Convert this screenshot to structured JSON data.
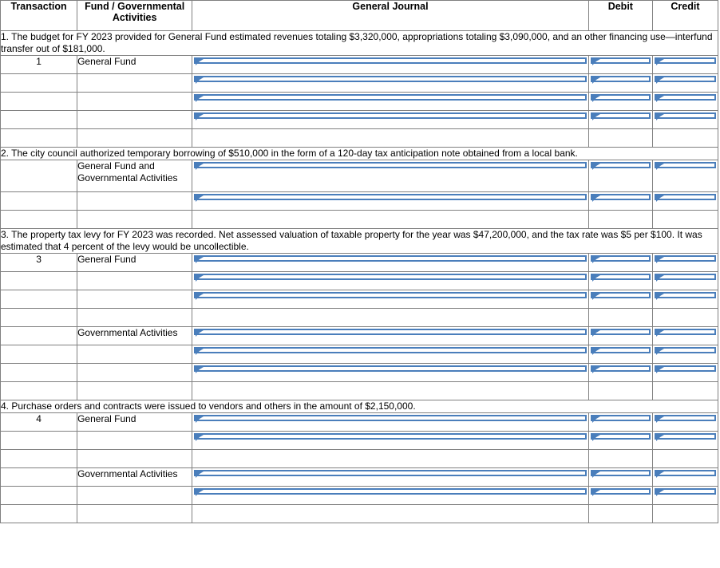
{
  "header": {
    "columns": [
      {
        "key": "transaction",
        "label": "Transaction"
      },
      {
        "key": "fund",
        "label": "Fund / Governmental Activities"
      },
      {
        "key": "general_journal",
        "label": "General Journal"
      },
      {
        "key": "debit",
        "label": "Debit"
      },
      {
        "key": "credit",
        "label": "Credit"
      }
    ]
  },
  "colors": {
    "header_bg": "#74A9DE",
    "field_border": "#4A7EBB",
    "grid_line": "#808080",
    "page_bg": "#FFFFFF"
  },
  "transactions": [
    {
      "id": "1",
      "description": "1. The budget for FY 2023 provided for General Fund estimated revenues totaling $3,320,000, appropriations totaling $3,090,000, and an other financing use—interfund transfer out of $181,000.",
      "rows": [
        {
          "transaction": "1",
          "fund": "General Fund",
          "general_journal": "",
          "debit": "",
          "credit": "",
          "has_fields": true
        },
        {
          "transaction": "",
          "fund": "",
          "general_journal": "",
          "debit": "",
          "credit": "",
          "has_fields": true
        },
        {
          "transaction": "",
          "fund": "",
          "general_journal": "",
          "debit": "",
          "credit": "",
          "has_fields": true
        },
        {
          "transaction": "",
          "fund": "",
          "general_journal": "",
          "debit": "",
          "credit": "",
          "has_fields": true
        },
        {
          "transaction": "",
          "fund": "",
          "general_journal": "",
          "debit": "",
          "credit": "",
          "has_fields": false
        }
      ]
    },
    {
      "id": "2",
      "description": "2. The city council authorized temporary borrowing of $510,000 in the form of a 120-day tax anticipation note obtained from a local bank.",
      "rows": [
        {
          "transaction": "",
          "fund": "General Fund and Governmental Activities",
          "general_journal": "",
          "debit": "",
          "credit": "",
          "has_fields": true,
          "tall": true
        },
        {
          "transaction": "",
          "fund": "",
          "general_journal": "",
          "debit": "",
          "credit": "",
          "has_fields": true
        },
        {
          "transaction": "",
          "fund": "",
          "general_journal": "",
          "debit": "",
          "credit": "",
          "has_fields": false
        }
      ]
    },
    {
      "id": "3",
      "description": "3. The property tax levy for FY 2023 was recorded. Net assessed valuation of taxable property for the year was $47,200,000, and the tax rate was $5 per $100. It was estimated that 4 percent of the levy would be uncollectible.",
      "rows": [
        {
          "transaction": "3",
          "fund": "General Fund",
          "general_journal": "",
          "debit": "",
          "credit": "",
          "has_fields": true
        },
        {
          "transaction": "",
          "fund": "",
          "general_journal": "",
          "debit": "",
          "credit": "",
          "has_fields": true
        },
        {
          "transaction": "",
          "fund": "",
          "general_journal": "",
          "debit": "",
          "credit": "",
          "has_fields": true
        },
        {
          "transaction": "",
          "fund": "",
          "general_journal": "",
          "debit": "",
          "credit": "",
          "has_fields": false
        },
        {
          "transaction": "",
          "fund": "Governmental Activities",
          "general_journal": "",
          "debit": "",
          "credit": "",
          "has_fields": true
        },
        {
          "transaction": "",
          "fund": "",
          "general_journal": "",
          "debit": "",
          "credit": "",
          "has_fields": true
        },
        {
          "transaction": "",
          "fund": "",
          "general_journal": "",
          "debit": "",
          "credit": "",
          "has_fields": true
        },
        {
          "transaction": "",
          "fund": "",
          "general_journal": "",
          "debit": "",
          "credit": "",
          "has_fields": false
        }
      ]
    },
    {
      "id": "4",
      "description": "4. Purchase orders and contracts were issued to vendors and others in the amount of $2,150,000.",
      "rows": [
        {
          "transaction": "4",
          "fund": "General Fund",
          "general_journal": "",
          "debit": "",
          "credit": "",
          "has_fields": true
        },
        {
          "transaction": "",
          "fund": "",
          "general_journal": "",
          "debit": "",
          "credit": "",
          "has_fields": true
        },
        {
          "transaction": "",
          "fund": "",
          "general_journal": "",
          "debit": "",
          "credit": "",
          "has_fields": false
        },
        {
          "transaction": "",
          "fund": "Governmental Activities",
          "general_journal": "",
          "debit": "",
          "credit": "",
          "has_fields": true
        },
        {
          "transaction": "",
          "fund": "",
          "general_journal": "",
          "debit": "",
          "credit": "",
          "has_fields": true
        },
        {
          "transaction": "",
          "fund": "",
          "general_journal": "",
          "debit": "",
          "credit": "",
          "has_fields": false
        }
      ]
    }
  ]
}
